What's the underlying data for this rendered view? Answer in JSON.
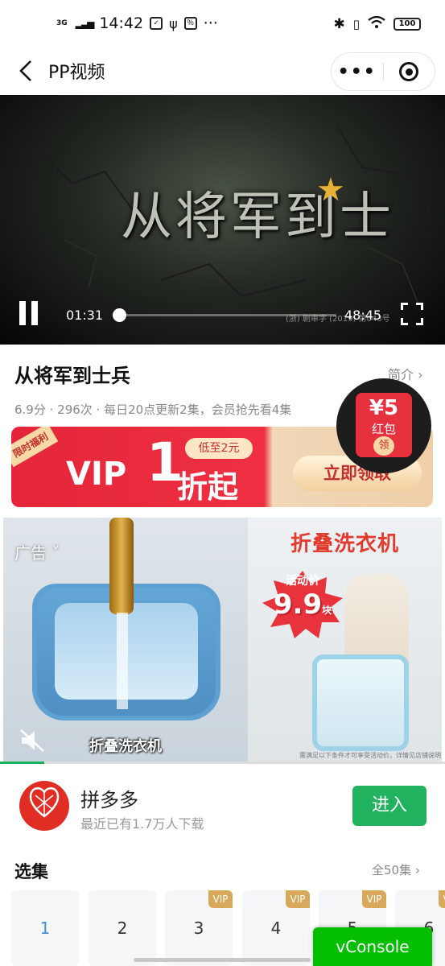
{
  "status_bar": {
    "network": "3G",
    "time": "14:42",
    "more": "···",
    "battery": "100"
  },
  "nav": {
    "title": "PP视频",
    "more": "•••"
  },
  "player": {
    "poster_title": "从将军到士",
    "current_time": "01:31",
    "duration": "48:45",
    "progress": 0.03,
    "license_text": "(浙) 剧审字 (2019) 第043号"
  },
  "info": {
    "title": "从将军到士兵",
    "intro_link": "简介 ›",
    "meta": "6.9分 · 296次 · 每日20点更新2集，会员抢先看4集"
  },
  "vip_banner": {
    "tag": "限时福利",
    "vip": "VIP",
    "one": "1",
    "low_price": "低至2元",
    "zheqi": "折起",
    "claim": "立即领取"
  },
  "red_packet": {
    "amount": "¥5",
    "label": "红包",
    "claim": "领"
  },
  "ad": {
    "label": "广告 ˅",
    "caption": "折叠洗衣机",
    "headline": "折叠洗衣机",
    "promo_label": "活动价",
    "price": "9.9",
    "unit": "块",
    "fine_print": "需满足以下条件才可享受活动价，详情见店铺说明",
    "progress": 0.1
  },
  "app": {
    "name": "拼多多",
    "subtitle": "最近已有1.7万人下载",
    "enter": "进入"
  },
  "episodes": {
    "title": "选集",
    "all": "全50集 ›",
    "items": [
      {
        "num": "1",
        "vip": ""
      },
      {
        "num": "2",
        "vip": ""
      },
      {
        "num": "3",
        "vip": "VIP"
      },
      {
        "num": "4",
        "vip": "VIP"
      },
      {
        "num": "5",
        "vip": "VIP"
      },
      {
        "num": "6",
        "vip": "VIP"
      }
    ]
  },
  "vconsole": "vConsole",
  "colors": {
    "accent_green": "#21b25f",
    "vip_red": "#e5263a",
    "episode_active": "#3d8fd9"
  }
}
